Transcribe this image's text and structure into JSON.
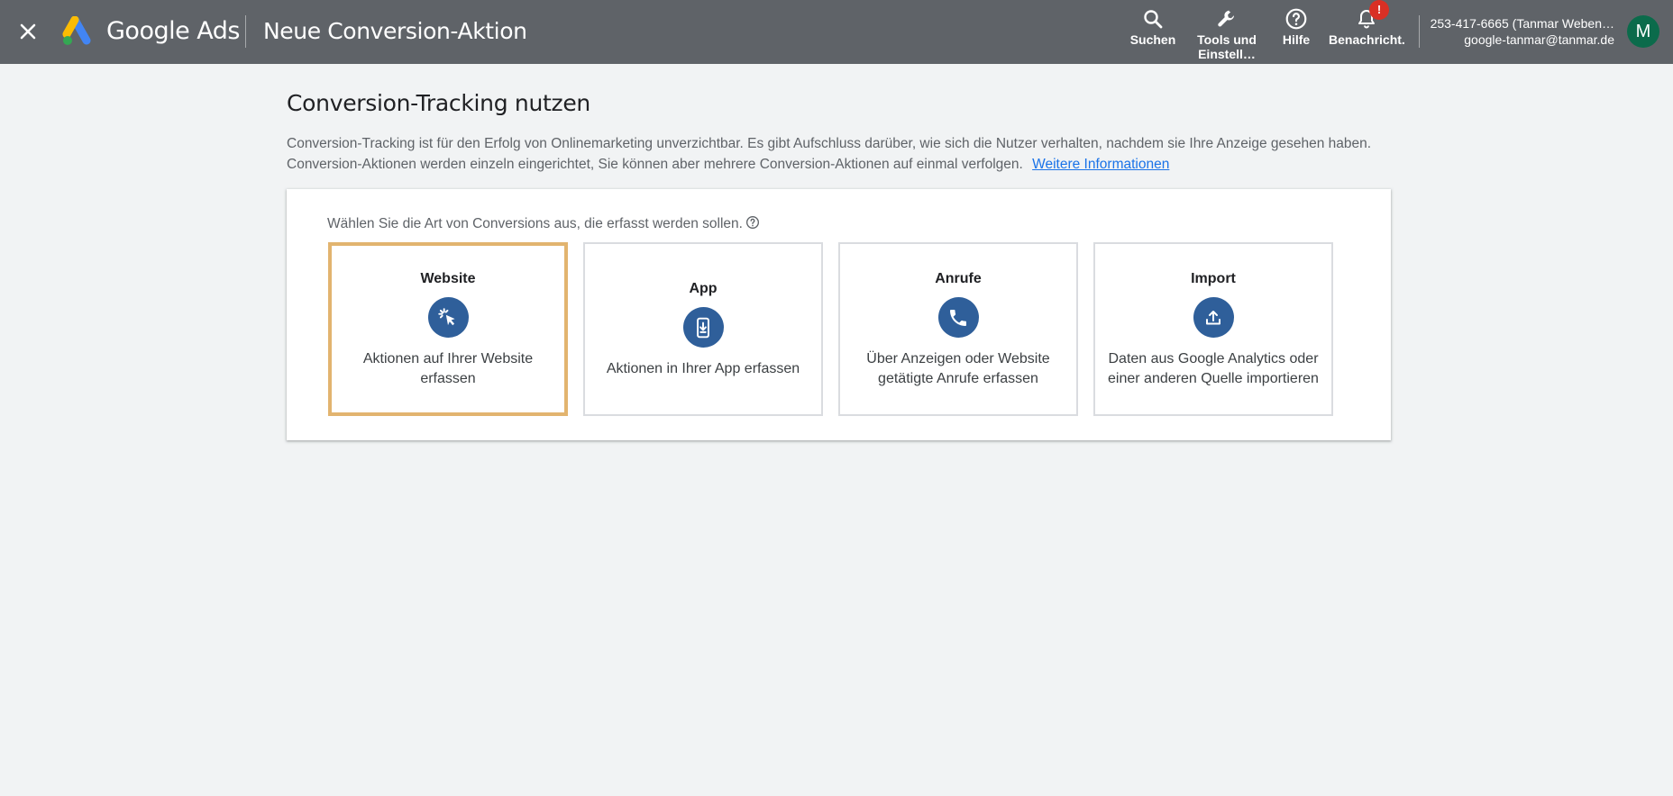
{
  "header": {
    "brand": "Google Ads",
    "title": "Neue Conversion-Aktion",
    "tools": [
      {
        "label": "Suchen",
        "icon": "search-icon"
      },
      {
        "label": "Tools und Einstell…",
        "icon": "wrench-icon"
      },
      {
        "label": "Hilfe",
        "icon": "help-circle-icon"
      },
      {
        "label": "Benachricht.",
        "icon": "bell-icon",
        "badge": "!"
      }
    ],
    "account": {
      "line1": "253-417-6665 (Tanmar Weben…",
      "line2": "google-tanmar@tanmar.de",
      "avatar_letter": "M"
    }
  },
  "main": {
    "heading": "Conversion-Tracking nutzen",
    "intro": "Conversion-Tracking ist für den Erfolg von Onlinemarketing unverzichtbar. Es gibt Aufschluss darüber, wie sich die Nutzer verhalten, nachdem sie Ihre Anzeige gesehen haben. Conversion-Aktionen werden einzeln eingerichtet, Sie können aber mehrere Conversion-Aktionen auf einmal verfolgen.",
    "learn_more": "Weitere Informationen",
    "select_label": "Wählen Sie die Art von Conversions aus, die erfasst werden sollen.",
    "options": [
      {
        "title": "Website",
        "desc": "Aktionen auf Ihrer Website erfassen",
        "icon": "cursor-click-icon",
        "selected": true
      },
      {
        "title": "App",
        "desc": "Aktionen in Ihrer App erfassen",
        "icon": "phone-download-icon",
        "selected": false
      },
      {
        "title": "Anrufe",
        "desc": "Über Anzeigen oder Website getätigte Anrufe erfassen",
        "icon": "phone-icon",
        "selected": false
      },
      {
        "title": "Import",
        "desc": "Daten aus Google Analytics oder einer anderen Quelle importieren",
        "icon": "upload-icon",
        "selected": false
      }
    ]
  },
  "colors": {
    "header_bg": "#5f6368",
    "page_bg": "#f1f3f4",
    "option_icon_bg": "#2f5f9a",
    "selected_border": "#e2b46f",
    "link": "#1a73e8",
    "badge": "#d93025",
    "avatar_bg": "#0b6b4b"
  }
}
